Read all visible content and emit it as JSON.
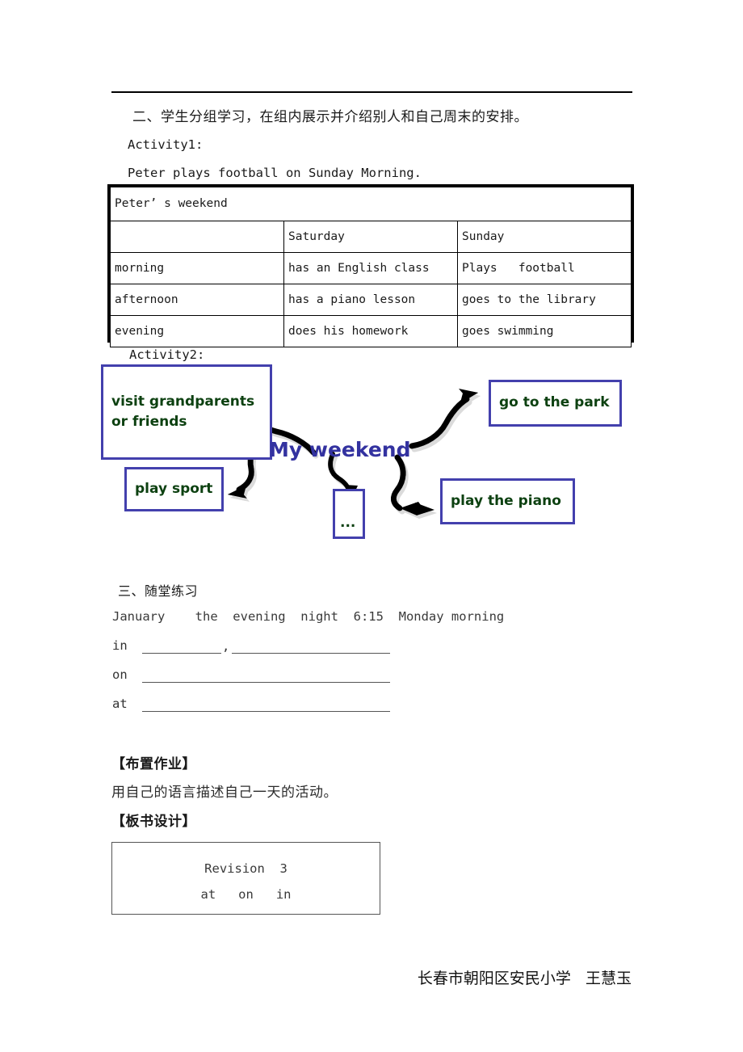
{
  "document": {
    "section_two_heading": "二、学生分组学习，在组内展示并介绍别人和自己周末的安排。",
    "activity1_label": "Activity1:",
    "activity1_example": "Peter plays football on Sunday Morning.",
    "activity2_label": "Activity2:",
    "section_three_heading": "三、随堂练习",
    "word_bank": "January    the  evening  night  6:15  Monday morning",
    "homework_heading": "【布置作业】",
    "homework_text": "用自己的语言描述自己一天的活动。",
    "board_heading": "【板书设计】",
    "footer": "长春市朝阳区安民小学   王慧玉"
  },
  "table": {
    "title": "Peter’ s weekend",
    "columns": [
      "",
      "Saturday",
      "Sunday"
    ],
    "rows": [
      {
        "label": "morning",
        "saturday": "has an English class",
        "sunday": "Plays   football"
      },
      {
        "label": "afternoon",
        "saturday": "has a piano lesson",
        "sunday": "goes to the library"
      },
      {
        "label": "evening",
        "saturday": "does his homework",
        "sunday": "goes swimming"
      }
    ]
  },
  "mindmap": {
    "center": "My weekend",
    "center_color": "#3332a0",
    "box_border_color": "#4340ad",
    "box_text_color": "#0d4111",
    "nodes": [
      {
        "id": "visit",
        "line1": "visit grandparents",
        "line2": "or friends"
      },
      {
        "id": "park",
        "line1": "go to the park",
        "line2": ""
      },
      {
        "id": "sport",
        "line1": "play sport",
        "line2": ""
      },
      {
        "id": "dots",
        "line1": "...",
        "line2": ""
      },
      {
        "id": "piano",
        "line1": "play the piano",
        "line2": ""
      }
    ]
  },
  "exercise": {
    "prefixes": [
      "in",
      "on",
      "at"
    ],
    "comma": ","
  },
  "board": {
    "line1": "Revision  3",
    "line2": "at   on   in"
  }
}
